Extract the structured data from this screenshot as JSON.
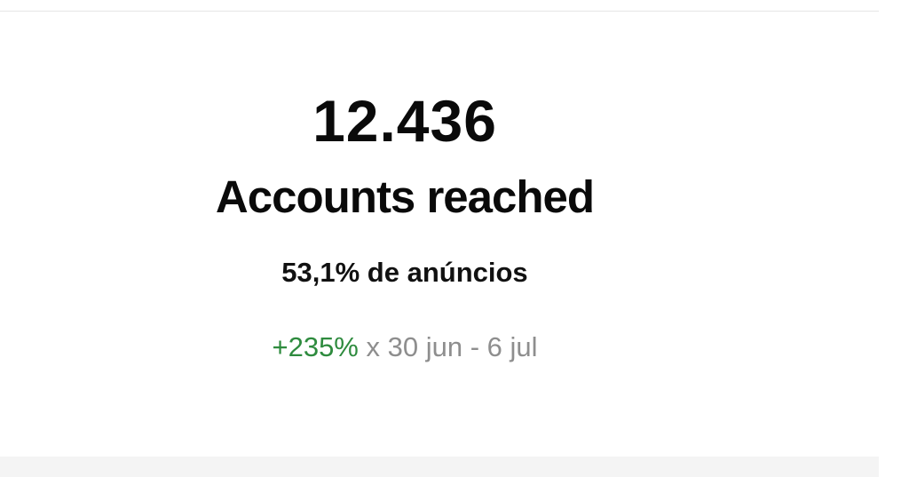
{
  "insights": {
    "value": "12.436",
    "label": "Accounts reached",
    "ads_share": "53,1% de anúncios",
    "change": {
      "percent": "+235%",
      "period": "x 30 jun - 6 jul"
    }
  },
  "colors": {
    "positive": "#2e8b3e",
    "muted": "#8e8e8e",
    "text": "#0a0a0a"
  }
}
